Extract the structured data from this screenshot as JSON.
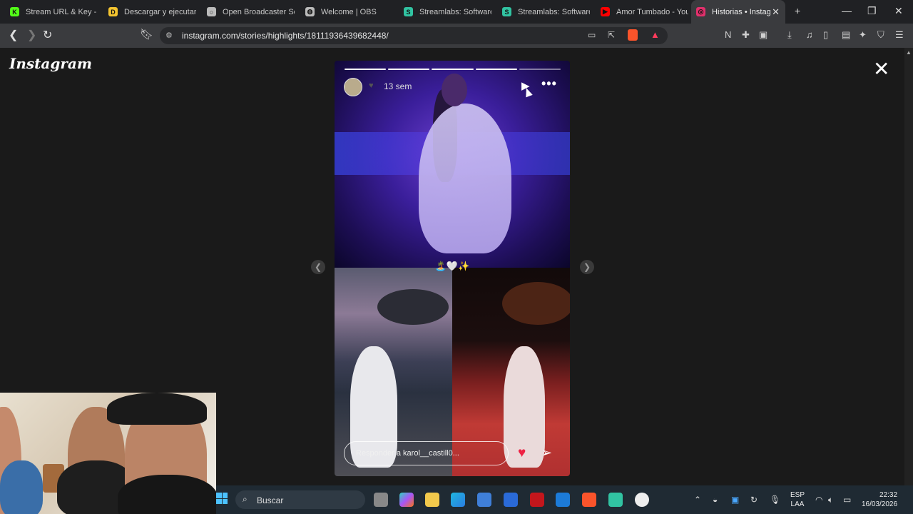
{
  "tabs": [
    {
      "title": "Stream URL & Key - K",
      "icon": "kick-icon",
      "color": "#53fc18",
      "glyph": "K"
    },
    {
      "title": "Descargar y ejecutar",
      "icon": "doc-icon",
      "color": "#f4c430",
      "glyph": "D"
    },
    {
      "title": "Open Broadcaster Sof",
      "icon": "github-icon",
      "color": "#bbbbbb",
      "glyph": "○"
    },
    {
      "title": "Welcome | OBS",
      "icon": "globe-icon",
      "color": "#bbbbbb",
      "glyph": "◍"
    },
    {
      "title": "Streamlabs: Software",
      "icon": "streamlabs-icon",
      "color": "#31c3a2",
      "glyph": "S"
    },
    {
      "title": "Streamlabs: Software",
      "icon": "streamlabs-icon",
      "color": "#31c3a2",
      "glyph": "S"
    },
    {
      "title": "Amor Tumbado - You",
      "icon": "youtube-icon",
      "color": "#ff0000",
      "glyph": "▶"
    },
    {
      "title": "Historias • Instag",
      "icon": "instagram-icon",
      "color": "#e1306c",
      "glyph": "◎"
    }
  ],
  "address": {
    "url": "instagram.com/stories/highlights/18111936439682448/"
  },
  "page": {
    "logo": "Instagram"
  },
  "story": {
    "time": "13 sem",
    "caption_emojis": "🏝️🤍✨",
    "reply_placeholder": "Responder a karol__castill0...",
    "segments_total": 5,
    "segments_done": 4
  },
  "taskbar": {
    "search": "Buscar",
    "lang_line1": "ESP",
    "lang_line2": "LAA",
    "time": "22:32",
    "date": "16/03/2026"
  }
}
